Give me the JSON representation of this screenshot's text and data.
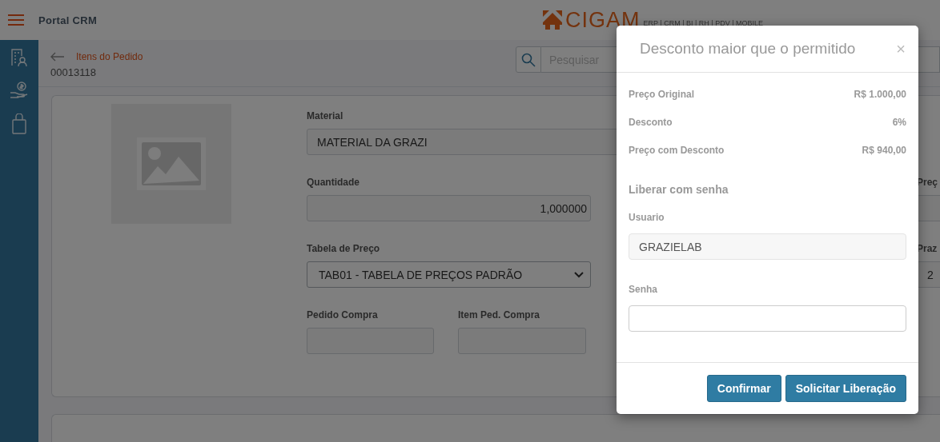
{
  "header": {
    "title": "Portal CRM",
    "logo": "CIGAM",
    "tagline": "ERP | CRM | BI | RH | PDV | MOBILE"
  },
  "breadcrumb": {
    "back": "Itens do Pedido",
    "order_number": "00013118"
  },
  "search": {
    "placeholder": "Pesquisar"
  },
  "form": {
    "material": {
      "label": "Material",
      "value": "MATERIAL DA GRAZI"
    },
    "quantity": {
      "label": "Quantidade",
      "value": "1,000000"
    },
    "price_table": {
      "label": "Tabela de Preço",
      "value": "TAB01 - TABELA DE PREÇOS PADRÃO"
    },
    "purchase_order": {
      "label": "Pedido Compra"
    },
    "purchase_item": {
      "label": "Item Ped. Compra"
    },
    "column_3": [
      {
        "label": "Preç"
      },
      {
        "label": "Praz",
        "value": "2"
      }
    ]
  },
  "modal": {
    "title": "Desconto maior que o permitido",
    "close": "×",
    "summary": [
      {
        "label": "Preço Original",
        "value": "R$ 1.000,00"
      },
      {
        "label": "Desconto",
        "value": "6%"
      },
      {
        "label": "Preço com Desconto",
        "value": "R$ 940,00"
      }
    ],
    "section": "Liberar com senha",
    "user": {
      "label": "Usuario",
      "value": "GRAZIELAB",
      "disabled": true
    },
    "password": {
      "label": "Senha"
    },
    "buttons": [
      "Confirmar",
      "Solicitar Liberação"
    ]
  }
}
